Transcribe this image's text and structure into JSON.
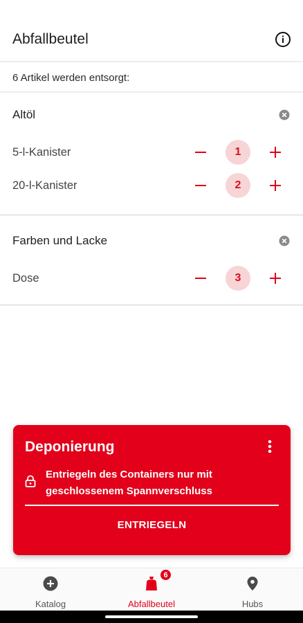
{
  "header": {
    "title": "Abfallbeutel",
    "info_icon": "info-icon"
  },
  "summary": "6 Artikel werden entsorgt:",
  "sections": [
    {
      "title": "Altöl",
      "items": [
        {
          "label": "5-l-Kanister",
          "quantity": "1"
        },
        {
          "label": "20-l-Kanister",
          "quantity": "2"
        }
      ]
    },
    {
      "title": "Farben und Lacke",
      "items": [
        {
          "label": "Dose",
          "quantity": "3"
        }
      ]
    }
  ],
  "card": {
    "title": "Deponierung",
    "message": "Entriegeln des Containers nur mit geschlossenem Spannverschluss",
    "action": "ENTRIEGELN"
  },
  "nav": [
    {
      "label": "Katalog",
      "icon": "plus-circle-icon"
    },
    {
      "label": "Abfallbeutel",
      "icon": "bag-icon",
      "badge": "6",
      "active": true
    },
    {
      "label": "Hubs",
      "icon": "location-pin-icon"
    }
  ],
  "colors": {
    "accent": "#e2001a",
    "qty_bg": "#f7d4d6"
  }
}
